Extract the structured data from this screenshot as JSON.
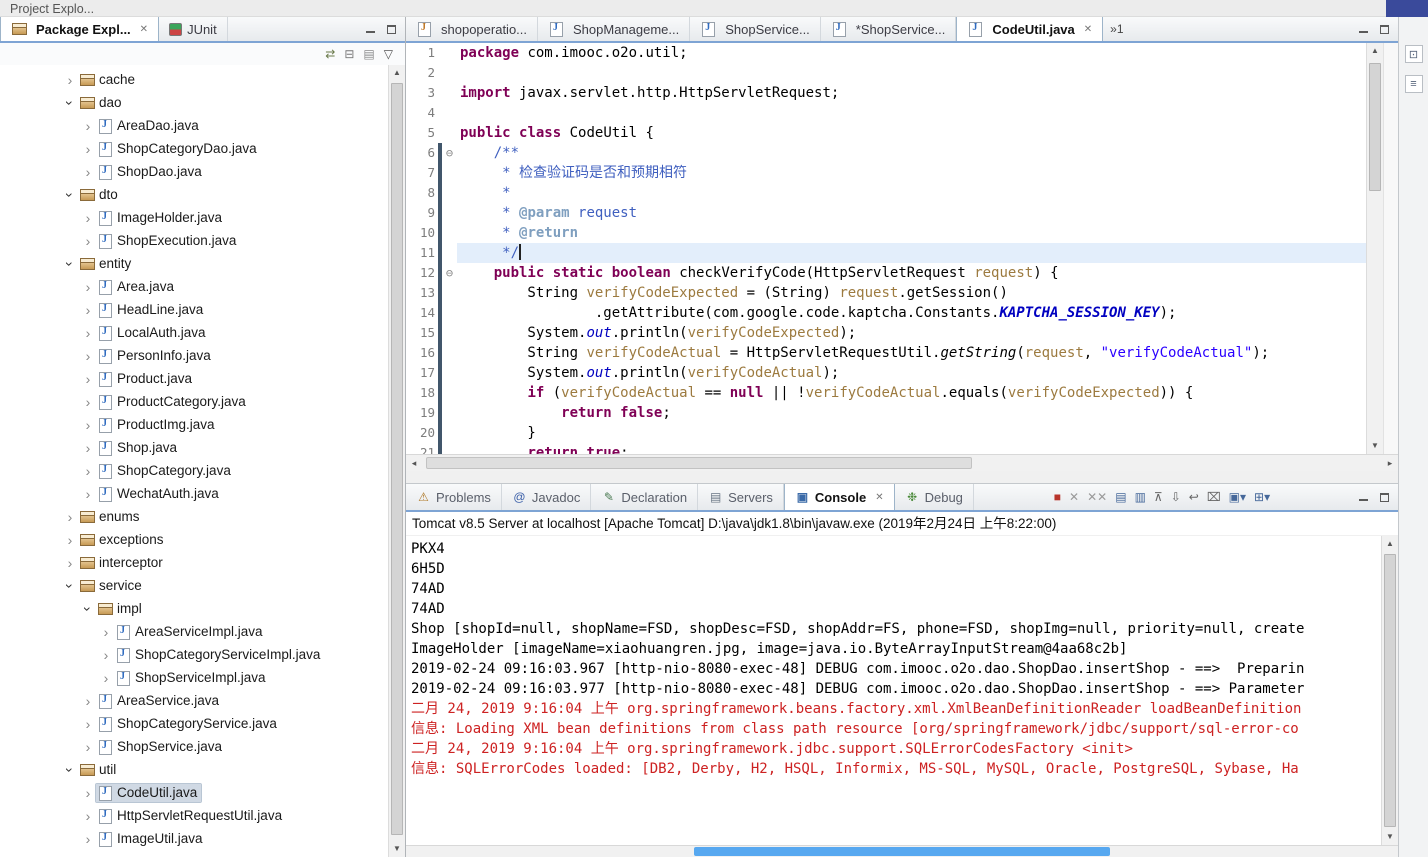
{
  "top_row": {
    "project_explorer_tab": "Project Explo..."
  },
  "left_panel": {
    "tabs": [
      {
        "label": "Package Expl...",
        "active": true
      },
      {
        "label": "JUnit",
        "active": false
      }
    ],
    "toolbar_icons": [
      {
        "name": "link-with-editor-icon",
        "glyph": "⇄",
        "color": "#6a7a4a"
      },
      {
        "name": "collapse-all-icon",
        "glyph": "⊟",
        "color": "#777777"
      },
      {
        "name": "filters-icon",
        "glyph": "▤",
        "color": "#8a8a8a"
      },
      {
        "name": "view-menu-icon",
        "glyph": "▽",
        "color": "#555555"
      }
    ],
    "tree": [
      {
        "label": "cache",
        "icon": "package",
        "level": 0,
        "state": "collapsed"
      },
      {
        "label": "dao",
        "icon": "package",
        "level": 0,
        "state": "expanded"
      },
      {
        "label": "AreaDao.java",
        "icon": "java",
        "level": 1,
        "state": "collapsed"
      },
      {
        "label": "ShopCategoryDao.java",
        "icon": "java",
        "level": 1,
        "state": "collapsed"
      },
      {
        "label": "ShopDao.java",
        "icon": "java",
        "level": 1,
        "state": "collapsed"
      },
      {
        "label": "dto",
        "icon": "package",
        "level": 0,
        "state": "expanded"
      },
      {
        "label": "ImageHolder.java",
        "icon": "java",
        "level": 1,
        "state": "collapsed"
      },
      {
        "label": "ShopExecution.java",
        "icon": "java",
        "level": 1,
        "state": "collapsed"
      },
      {
        "label": "entity",
        "icon": "package",
        "level": 0,
        "state": "expanded"
      },
      {
        "label": "Area.java",
        "icon": "java",
        "level": 1,
        "state": "collapsed"
      },
      {
        "label": "HeadLine.java",
        "icon": "java",
        "level": 1,
        "state": "collapsed"
      },
      {
        "label": "LocalAuth.java",
        "icon": "java",
        "level": 1,
        "state": "collapsed"
      },
      {
        "label": "PersonInfo.java",
        "icon": "java",
        "level": 1,
        "state": "collapsed"
      },
      {
        "label": "Product.java",
        "icon": "java",
        "level": 1,
        "state": "collapsed"
      },
      {
        "label": "ProductCategory.java",
        "icon": "java",
        "level": 1,
        "state": "collapsed"
      },
      {
        "label": "ProductImg.java",
        "icon": "java",
        "level": 1,
        "state": "collapsed"
      },
      {
        "label": "Shop.java",
        "icon": "java",
        "level": 1,
        "state": "collapsed"
      },
      {
        "label": "ShopCategory.java",
        "icon": "java",
        "level": 1,
        "state": "collapsed"
      },
      {
        "label": "WechatAuth.java",
        "icon": "java",
        "level": 1,
        "state": "collapsed"
      },
      {
        "label": "enums",
        "icon": "package",
        "level": 0,
        "state": "collapsed"
      },
      {
        "label": "exceptions",
        "icon": "package",
        "level": 0,
        "state": "collapsed"
      },
      {
        "label": "interceptor",
        "icon": "package",
        "level": 0,
        "state": "collapsed"
      },
      {
        "label": "service",
        "icon": "package",
        "level": 0,
        "state": "expanded"
      },
      {
        "label": "impl",
        "icon": "package",
        "level": 1,
        "state": "expanded"
      },
      {
        "label": "AreaServiceImpl.java",
        "icon": "java",
        "level": 2,
        "state": "collapsed"
      },
      {
        "label": "ShopCategoryServiceImpl.java",
        "icon": "java",
        "level": 2,
        "state": "collapsed"
      },
      {
        "label": "ShopServiceImpl.java",
        "icon": "java",
        "level": 2,
        "state": "collapsed"
      },
      {
        "label": "AreaService.java",
        "icon": "java",
        "level": 1,
        "state": "collapsed"
      },
      {
        "label": "ShopCategoryService.java",
        "icon": "java",
        "level": 1,
        "state": "collapsed"
      },
      {
        "label": "ShopService.java",
        "icon": "java",
        "level": 1,
        "state": "collapsed"
      },
      {
        "label": "util",
        "icon": "package",
        "level": 0,
        "state": "expanded"
      },
      {
        "label": "CodeUtil.java",
        "icon": "java",
        "level": 1,
        "state": "collapsed",
        "selected": true
      },
      {
        "label": "HttpServletRequestUtil.java",
        "icon": "java",
        "level": 1,
        "state": "collapsed"
      },
      {
        "label": "ImageUtil.java",
        "icon": "java",
        "level": 1,
        "state": "collapsed"
      }
    ]
  },
  "editor": {
    "tabs": [
      {
        "label": "shopoperatio...",
        "icon": "jsp",
        "active": false
      },
      {
        "label": "ShopManageme...",
        "icon": "java",
        "active": false
      },
      {
        "label": "ShopService...",
        "icon": "java",
        "active": false
      },
      {
        "label": "*ShopService...",
        "icon": "java",
        "active": false
      },
      {
        "label": "CodeUtil.java",
        "icon": "java",
        "active": true
      }
    ],
    "overflow_label": "»1",
    "lines": [
      {
        "num": "1",
        "seg": [
          {
            "c": "kw",
            "t": "package"
          },
          {
            "c": "pln",
            "t": " com.imooc.o2o.util;"
          }
        ]
      },
      {
        "num": "2",
        "seg": []
      },
      {
        "num": "3",
        "seg": [
          {
            "c": "kw",
            "t": "import"
          },
          {
            "c": "pln",
            "t": " javax.servlet.http.HttpServletRequest;"
          }
        ]
      },
      {
        "num": "4",
        "seg": []
      },
      {
        "num": "5",
        "seg": [
          {
            "c": "kw",
            "t": "public"
          },
          {
            "c": "pln",
            "t": " "
          },
          {
            "c": "kw",
            "t": "class"
          },
          {
            "c": "pln",
            "t": " CodeUtil {"
          }
        ]
      },
      {
        "num": "6",
        "fold": true,
        "chg": true,
        "seg": [
          {
            "c": "doc",
            "t": "    /**"
          }
        ]
      },
      {
        "num": "7",
        "chg": true,
        "seg": [
          {
            "c": "doc",
            "t": "     * 检查验证码是否和预期相符"
          }
        ]
      },
      {
        "num": "8",
        "chg": true,
        "seg": [
          {
            "c": "doc",
            "t": "     *"
          }
        ]
      },
      {
        "num": "9",
        "chg": true,
        "seg": [
          {
            "c": "doc",
            "t": "     * "
          },
          {
            "c": "tag",
            "t": "@param"
          },
          {
            "c": "doc",
            "t": " request"
          }
        ]
      },
      {
        "num": "10",
        "chg": true,
        "seg": [
          {
            "c": "doc",
            "t": "     * "
          },
          {
            "c": "tag",
            "t": "@return"
          }
        ]
      },
      {
        "num": "11",
        "chg": true,
        "current": true,
        "caret": true,
        "seg": [
          {
            "c": "doc",
            "t": "     */"
          }
        ]
      },
      {
        "num": "12",
        "fold": true,
        "chg": true,
        "seg": [
          {
            "c": "pln",
            "t": "    "
          },
          {
            "c": "kw",
            "t": "public"
          },
          {
            "c": "pln",
            "t": " "
          },
          {
            "c": "kw",
            "t": "static"
          },
          {
            "c": "pln",
            "t": " "
          },
          {
            "c": "kw",
            "t": "boolean"
          },
          {
            "c": "pln",
            "t": " checkVerifyCode(HttpServletRequest "
          },
          {
            "c": "loc",
            "t": "request"
          },
          {
            "c": "pln",
            "t": ") {"
          }
        ]
      },
      {
        "num": "13",
        "chg": true,
        "seg": [
          {
            "c": "pln",
            "t": "        String "
          },
          {
            "c": "loc",
            "t": "verifyCodeExpected"
          },
          {
            "c": "pln",
            "t": " = (String) "
          },
          {
            "c": "loc",
            "t": "request"
          },
          {
            "c": "pln",
            "t": ".getSession()"
          }
        ]
      },
      {
        "num": "14",
        "chg": true,
        "seg": [
          {
            "c": "pln",
            "t": "                .getAttribute(com.google.code.kaptcha.Constants."
          },
          {
            "c": "con",
            "t": "KAPTCHA_SESSION_KEY"
          },
          {
            "c": "pln",
            "t": ");"
          }
        ]
      },
      {
        "num": "15",
        "chg": true,
        "seg": [
          {
            "c": "pln",
            "t": "        System."
          },
          {
            "c": "fld",
            "t": "out"
          },
          {
            "c": "pln",
            "t": ".println("
          },
          {
            "c": "loc",
            "t": "verifyCodeExpected"
          },
          {
            "c": "pln",
            "t": ");"
          }
        ]
      },
      {
        "num": "16",
        "chg": true,
        "seg": [
          {
            "c": "pln",
            "t": "        String "
          },
          {
            "c": "loc",
            "t": "verifyCodeActual"
          },
          {
            "c": "pln",
            "t": " = HttpServletRequestUtil."
          },
          {
            "c": "sm",
            "t": "getString"
          },
          {
            "c": "pln",
            "t": "("
          },
          {
            "c": "loc",
            "t": "request"
          },
          {
            "c": "pln",
            "t": ", "
          },
          {
            "c": "str",
            "t": "\"verifyCodeActual\""
          },
          {
            "c": "pln",
            "t": ");"
          }
        ]
      },
      {
        "num": "17",
        "chg": true,
        "seg": [
          {
            "c": "pln",
            "t": "        System."
          },
          {
            "c": "fld",
            "t": "out"
          },
          {
            "c": "pln",
            "t": ".println("
          },
          {
            "c": "loc",
            "t": "verifyCodeActual"
          },
          {
            "c": "pln",
            "t": ");"
          }
        ]
      },
      {
        "num": "18",
        "chg": true,
        "seg": [
          {
            "c": "pln",
            "t": "        "
          },
          {
            "c": "kw",
            "t": "if"
          },
          {
            "c": "pln",
            "t": " ("
          },
          {
            "c": "loc",
            "t": "verifyCodeActual"
          },
          {
            "c": "pln",
            "t": " == "
          },
          {
            "c": "kw",
            "t": "null"
          },
          {
            "c": "pln",
            "t": " || !"
          },
          {
            "c": "loc",
            "t": "verifyCodeActual"
          },
          {
            "c": "pln",
            "t": ".equals("
          },
          {
            "c": "loc",
            "t": "verifyCodeExpected"
          },
          {
            "c": "pln",
            "t": ")) {"
          }
        ]
      },
      {
        "num": "19",
        "chg": true,
        "seg": [
          {
            "c": "pln",
            "t": "            "
          },
          {
            "c": "kw",
            "t": "return"
          },
          {
            "c": "pln",
            "t": " "
          },
          {
            "c": "kw",
            "t": "false"
          },
          {
            "c": "pln",
            "t": ";"
          }
        ]
      },
      {
        "num": "20",
        "chg": true,
        "seg": [
          {
            "c": "pln",
            "t": "        }"
          }
        ]
      },
      {
        "num": "21",
        "chg": true,
        "seg": [
          {
            "c": "pln",
            "t": "        "
          },
          {
            "c": "kw",
            "t": "return"
          },
          {
            "c": "pln",
            "t": " "
          },
          {
            "c": "kw",
            "t": "true"
          },
          {
            "c": "pln",
            "t": ";"
          }
        ]
      }
    ]
  },
  "console": {
    "tabs": [
      {
        "label": "Problems",
        "icon": "problems-view-icon",
        "glyph": "⚠",
        "glyph_color": "#b07a28",
        "active": false
      },
      {
        "label": "Javadoc",
        "icon": "javadoc-view-icon",
        "glyph": "@",
        "glyph_color": "#3b5fa8",
        "active": false
      },
      {
        "label": "Declaration",
        "icon": "declaration-view-icon",
        "glyph": "✎",
        "glyph_color": "#4a7a52",
        "active": false
      },
      {
        "label": "Servers",
        "icon": "servers-view-icon",
        "glyph": "▤",
        "glyph_color": "#6a7684",
        "active": false
      },
      {
        "label": "Console",
        "icon": "console-view-icon",
        "glyph": "▣",
        "glyph_color": "#3a6aa8",
        "active": true
      },
      {
        "label": "Debug",
        "icon": "debug-view-icon",
        "glyph": "❉",
        "glyph_color": "#4a8a3a",
        "active": false
      }
    ],
    "toolbar_icons": [
      {
        "name": "terminate-icon",
        "glyph": "■",
        "color": "#b8352c"
      },
      {
        "name": "remove-launch-icon",
        "glyph": "✕",
        "color": "#9a9a9a"
      },
      {
        "name": "remove-all-terminated-icon",
        "glyph": "✕✕",
        "color": "#9a9a9a"
      },
      {
        "name": "show-console-stdout-icon",
        "glyph": "▤",
        "color": "#46689a"
      },
      {
        "name": "show-console-stderr-icon",
        "glyph": "▥",
        "color": "#46689a"
      },
      {
        "name": "pin-console-icon",
        "glyph": "⊼",
        "color": "#666666"
      },
      {
        "name": "scroll-lock-icon",
        "glyph": "⇩",
        "color": "#666666"
      },
      {
        "name": "word-wrap-icon",
        "glyph": "↩",
        "color": "#666666"
      },
      {
        "name": "clear-console-icon",
        "glyph": "⌧",
        "color": "#666666"
      },
      {
        "name": "display-console-menu-icon",
        "glyph": "▣▾",
        "color": "#46689a"
      },
      {
        "name": "open-console-menu-icon",
        "glyph": "⊞▾",
        "color": "#46689a"
      }
    ],
    "header": "Tomcat v8.5 Server at localhost [Apache Tomcat] D:\\java\\jdk1.8\\bin\\javaw.exe (2019年2月24日 上午8:22:00)",
    "lines": [
      {
        "stream": "out",
        "text": "PKX4"
      },
      {
        "stream": "out",
        "text": "6H5D"
      },
      {
        "stream": "out",
        "text": "74AD"
      },
      {
        "stream": "out",
        "text": "74AD"
      },
      {
        "stream": "out",
        "text": "Shop [shopId=null, shopName=FSD, shopDesc=FSD, shopAddr=FS, phone=FSD, shopImg=null, priority=null, create"
      },
      {
        "stream": "out",
        "text": "ImageHolder [imageName=xiaohuangren.jpg, image=java.io.ByteArrayInputStream@4aa68c2b]"
      },
      {
        "stream": "out",
        "text": "2019-02-24 09:16:03.967 [http-nio-8080-exec-48] DEBUG com.imooc.o2o.dao.ShopDao.insertShop - ==>  Preparin"
      },
      {
        "stream": "out",
        "text": "2019-02-24 09:16:03.977 [http-nio-8080-exec-48] DEBUG com.imooc.o2o.dao.ShopDao.insertShop - ==> Parameter"
      },
      {
        "stream": "err",
        "text": "二月 24, 2019 9:16:04 上午 org.springframework.beans.factory.xml.XmlBeanDefinitionReader loadBeanDefinition"
      },
      {
        "stream": "err",
        "text": "信息: Loading XML bean definitions from class path resource [org/springframework/jdbc/support/sql-error-co"
      },
      {
        "stream": "err",
        "text": "二月 24, 2019 9:16:04 上午 org.springframework.jdbc.support.SQLErrorCodesFactory <init>"
      },
      {
        "stream": "err",
        "text": "信息: SQLErrorCodes loaded: [DB2, Derby, H2, HSQL, Informix, MS-SQL, MySQL, Oracle, PostgreSQL, Sybase, Ha"
      }
    ]
  },
  "right_strip_icons": [
    {
      "name": "restore-view-icon",
      "glyph": "⊡",
      "color": "#55637a"
    },
    {
      "name": "outline-view-icon",
      "glyph": "≡",
      "color": "#55637a"
    }
  ]
}
